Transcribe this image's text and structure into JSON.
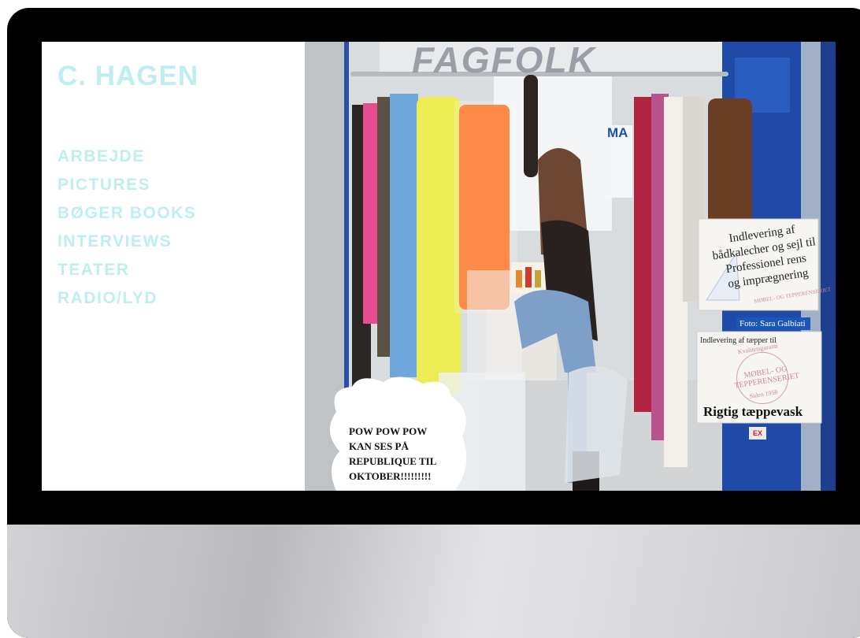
{
  "site": {
    "title": "C. HAGEN",
    "menu": [
      "ARBEJDE",
      "PICTURES",
      "BØGER BOOKS",
      "INTERVIEWS",
      "TEATER",
      "RADIO/LYD"
    ]
  },
  "photo": {
    "store_sign": "FAGFOLK",
    "ma_sign": "MA",
    "sign1_lines": [
      "Indlevering af",
      "bådkalecher og sejl til",
      "Professionel rens",
      "og imprægnering"
    ],
    "sign1_stamp": "MØBEL- OG TEPPERENSERIET",
    "photo_credit": "Foto: Sara Galbiati",
    "sign2_small": "Indlevering af tæpper til",
    "sign2_stamp_top": "Kvalitetsgaranti",
    "sign2_stamp": "MØBEL- OG TEPPERENSERIET",
    "sign2_stamp_bottom": "Siden 1958",
    "sign2_big": "Rigtig tæppevask",
    "badge": "EX",
    "speech_bubble_lines": [
      "POW POW POW",
      "KAN SES PÅ",
      "REPUBLIQUE TIL",
      "OKTOBER!!!!!!!!!"
    ]
  },
  "colors": {
    "accent": "#bfeeee",
    "bezel": "#000000",
    "chin": "#c9c9cc"
  }
}
